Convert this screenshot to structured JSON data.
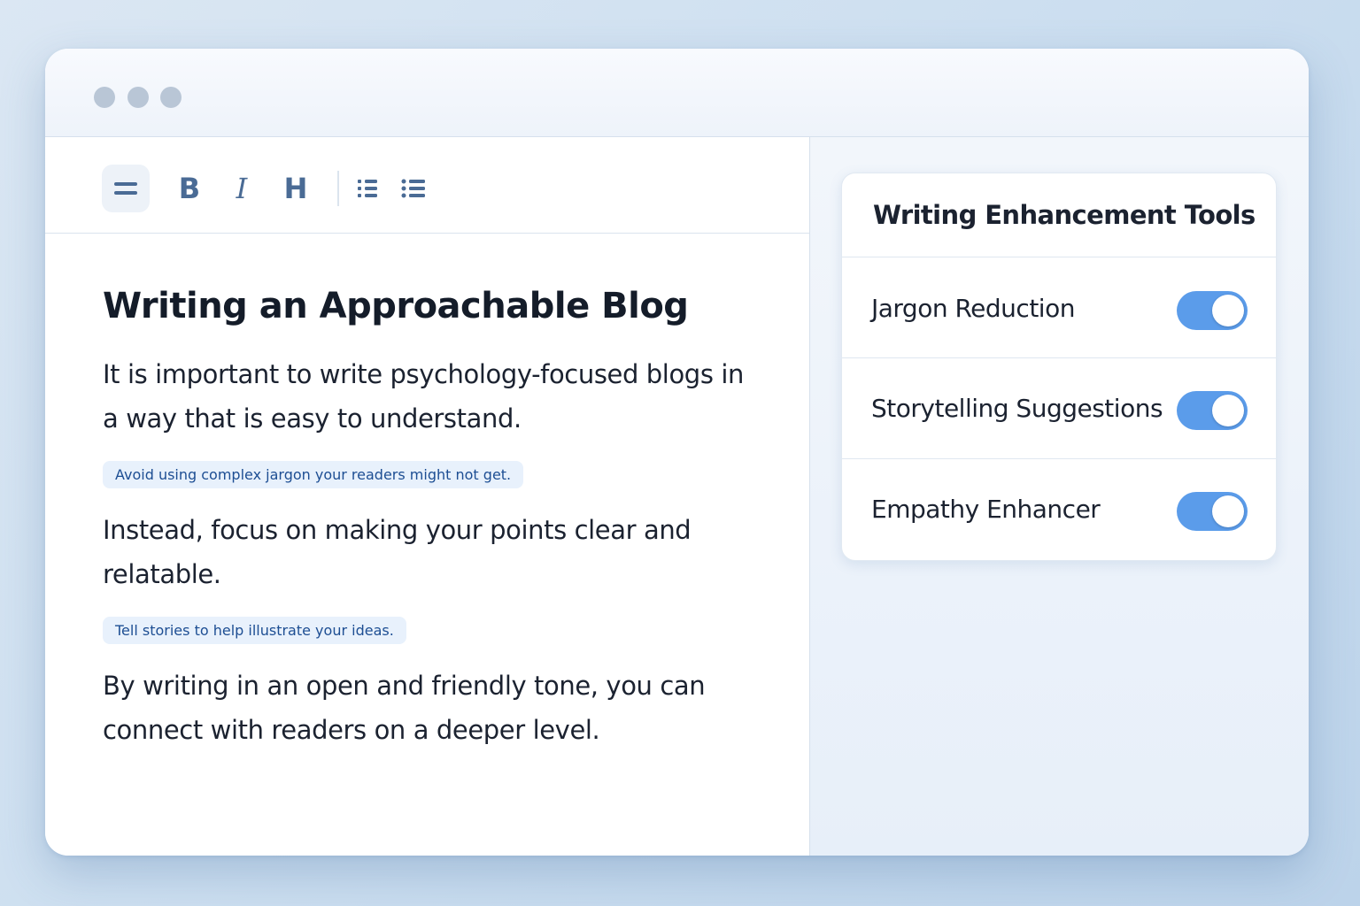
{
  "toolbar": {
    "buttons": [
      {
        "name": "paragraph-align",
        "icon": "equals-icon",
        "active": true
      },
      {
        "name": "bold",
        "label": "B"
      },
      {
        "name": "italic",
        "label": "I"
      },
      {
        "name": "heading",
        "label": "H"
      },
      {
        "name": "bulleted-list",
        "icon": "bulleted-list-icon"
      },
      {
        "name": "list",
        "icon": "list-icon"
      }
    ]
  },
  "editor": {
    "title": "Writing an Approachable Blog",
    "paragraph1": "It is important to write psychology-focused blogs in a way that is easy to understand.",
    "highlight1": "Avoid using complex jargon your readers might not get.",
    "paragraph2": "Instead, focus on making your points clear and relatable.",
    "highlight2": "Tell stories to help illustrate your ideas.",
    "paragraph3": "By writing in an open and friendly tone, you can connect with readers on a deeper level."
  },
  "tools_panel": {
    "title": "Writing Enhancement Tools",
    "items": [
      {
        "label": "Jargon Reduction",
        "enabled": true
      },
      {
        "label": "Storytelling Suggestions",
        "enabled": true
      },
      {
        "label": "Empathy Enhancer",
        "enabled": true
      }
    ]
  },
  "colors": {
    "accent": "#5b9cea",
    "highlight_bg": "#e8f1fc",
    "highlight_text": "#1d4e93",
    "icon": "#4a6b95"
  }
}
